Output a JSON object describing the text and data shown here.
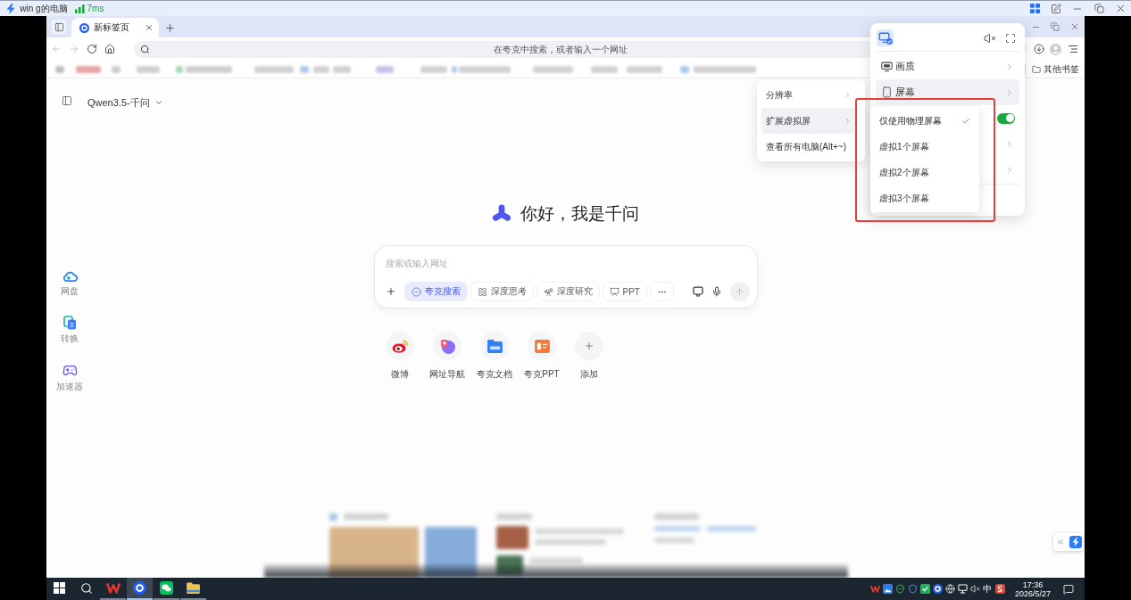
{
  "client_bar": {
    "computer_name": "win g的电脑",
    "latency": "7ms"
  },
  "browser": {
    "tabs": [
      {
        "title": "新标签页",
        "selected": true
      }
    ],
    "address_bar": {
      "placeholder": "在夸克中搜索，或者输入一个网址"
    },
    "bookmarks_bar": {
      "other_bookmarks": "其他书签"
    }
  },
  "new_tab_page": {
    "model_selector": "Qwen3.5-千问",
    "side_tools": [
      {
        "kind": "cloud",
        "label": "网盘"
      },
      {
        "kind": "convert",
        "label": "转换"
      },
      {
        "kind": "accelerator",
        "label": "加速器"
      }
    ],
    "greeting": "你好，我是千问",
    "search_box": {
      "placeholder": "搜索或输入网址",
      "modes": [
        {
          "kind": "search",
          "label": "夸克搜索",
          "selected": true
        },
        {
          "kind": "think",
          "label": "深度思考",
          "selected": false
        },
        {
          "kind": "research",
          "label": "深度研究",
          "selected": false
        },
        {
          "kind": "ppt",
          "label": "PPT",
          "selected": false
        },
        {
          "kind": "more",
          "selected": false
        }
      ]
    },
    "shortcuts": [
      {
        "kind": "weibo",
        "label": "微博"
      },
      {
        "kind": "navigation",
        "label": "网址导航"
      },
      {
        "kind": "doc",
        "label": "夸克文档"
      },
      {
        "kind": "ppt",
        "label": "夸克PPT"
      },
      {
        "kind": "add",
        "label": "添加"
      }
    ]
  },
  "remote_panel": {
    "rows": [
      {
        "kind": "quality",
        "label": "画质",
        "selected": false
      },
      {
        "kind": "screen",
        "label": "屏幕",
        "selected": true
      },
      {
        "kind": "toggle",
        "on": true,
        "selected": false
      },
      {
        "kind": "submenu",
        "selected": false
      },
      {
        "kind": "submenu",
        "selected": false
      }
    ]
  },
  "display_menu": [
    {
      "label": "分辨率",
      "has_submenu": true,
      "selected": false
    },
    {
      "label": "扩展虚拟屏",
      "has_submenu": true,
      "selected": true
    },
    {
      "label": "查看所有电脑(Alt+~)",
      "has_submenu": false,
      "selected": false
    }
  ],
  "virtual_screen_menu": [
    {
      "label": "仅使用物理屏幕",
      "checked": true
    },
    {
      "label": "虚拟1个屏幕",
      "checked": false
    },
    {
      "label": "虚拟2个屏幕",
      "checked": false
    },
    {
      "label": "虚拟3个屏幕",
      "checked": false
    }
  ],
  "taskbar": {
    "apps": [
      {
        "kind": "wps",
        "selected": false
      },
      {
        "kind": "browser",
        "selected": true
      },
      {
        "kind": "wechat",
        "selected": false
      },
      {
        "kind": "files",
        "selected": false
      }
    ],
    "input_method": "中",
    "time": "17:36",
    "date": "2026/5/27"
  }
}
